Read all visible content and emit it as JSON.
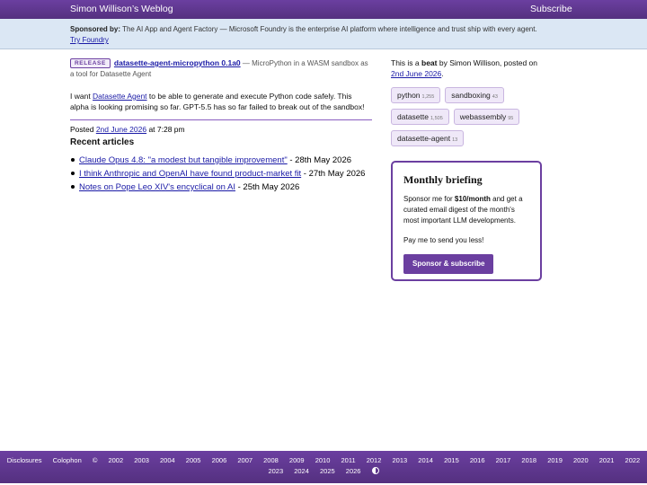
{
  "header": {
    "site_title": "Simon Willison’s Weblog",
    "subscribe": "Subscribe"
  },
  "sponsor": {
    "label": "Sponsored by:",
    "text": "The AI App and Agent Factory — Microsoft Foundry is the enterprise AI platform where intelligence and trust ship with every agent.",
    "link": "Try Foundry"
  },
  "entry": {
    "badge": "RELEASE",
    "title": "datasette-agent-micropython 0.1a0",
    "description": "— MicroPython in a WASM sandbox as a tool for Datasette Agent",
    "body_pre": "I want ",
    "body_link": "Datasette Agent",
    "body_post": " to be able to generate and execute Python code safely. This alpha is looking promising so far. GPT-5.5 has so far failed to break out of the sandbox!",
    "posted_label": "Posted ",
    "posted_date": "2nd June 2026",
    "posted_time": " at 7:28 pm"
  },
  "recent": {
    "title": "Recent articles",
    "items": [
      {
        "link": "Claude Opus 4.8: \"a modest but tangible improvement\"",
        "date": " - 28th May 2026"
      },
      {
        "link": "I think Anthropic and OpenAI have found product-market fit",
        "date": " - 27th May 2026"
      },
      {
        "link": "Notes on Pope Leo XIV's encyclical on AI",
        "date": " - 25th May 2026"
      }
    ]
  },
  "beat": {
    "pre": "This is a ",
    "word": "beat",
    "mid": " by Simon Willison, posted on ",
    "date": "2nd June 2026",
    "end": "."
  },
  "tags": [
    {
      "name": "python",
      "count": "1,255"
    },
    {
      "name": "sandboxing",
      "count": "43"
    },
    {
      "name": "datasette",
      "count": "1,505"
    },
    {
      "name": "webassembly",
      "count": "95"
    },
    {
      "name": "datasette-agent",
      "count": "13"
    }
  ],
  "briefing": {
    "title": "Monthly briefing",
    "text_pre": "Sponsor me for ",
    "price": "$10/month",
    "text_post": " and get a curated email digest of the month's most important LLM developments.",
    "pay": "Pay me to send you less!",
    "button": "Sponsor & subscribe"
  },
  "footer": {
    "links": [
      "Disclosures",
      "Colophon",
      "©"
    ],
    "years_row1": [
      "2002",
      "2003",
      "2004",
      "2005",
      "2006",
      "2007",
      "2008",
      "2009",
      "2010",
      "2011",
      "2012",
      "2013",
      "2014",
      "2015",
      "2016",
      "2017",
      "2018",
      "2019",
      "2020",
      "2021",
      "2022"
    ],
    "years_row2": [
      "2023",
      "2024",
      "2025",
      "2026"
    ],
    "contrast_icon": "contrast-icon"
  }
}
